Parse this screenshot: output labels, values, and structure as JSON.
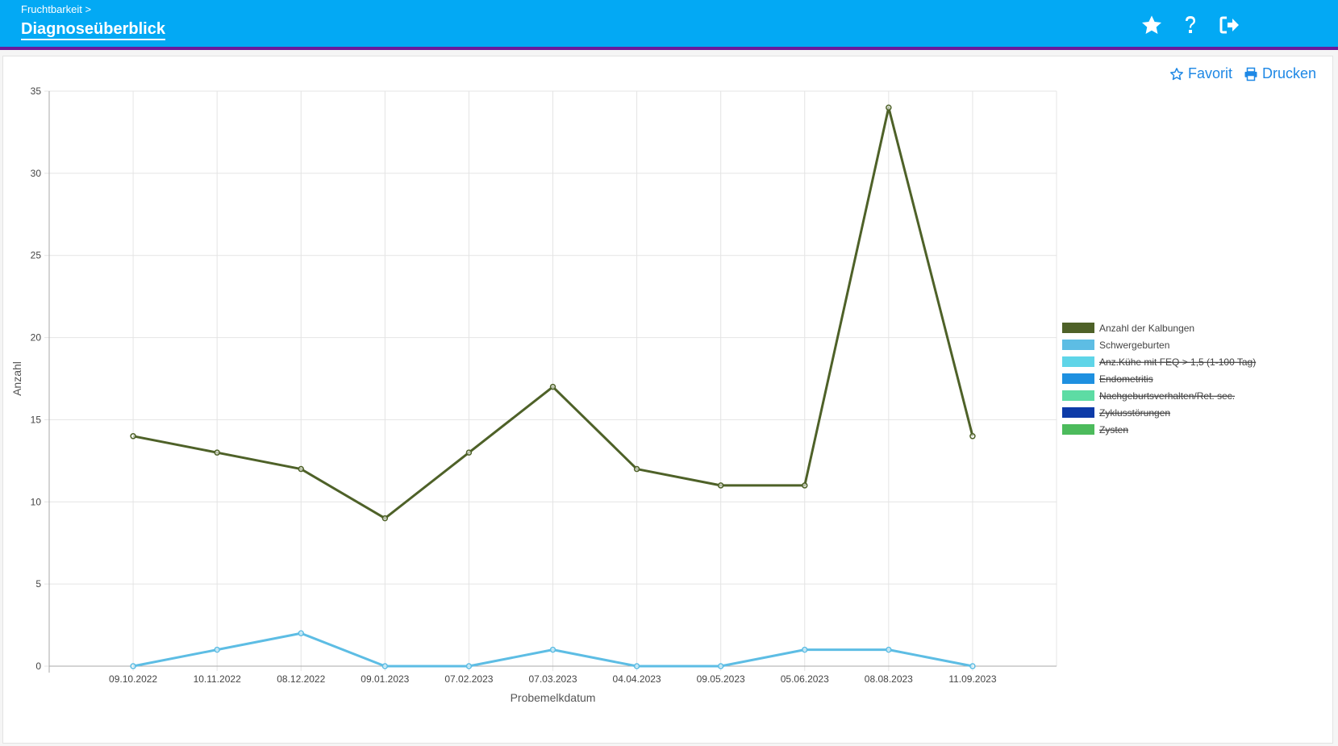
{
  "header": {
    "breadcrumb": "Fruchtbarkeit >",
    "title": "Diagnoseüberblick",
    "icons": [
      "star-icon",
      "question-icon",
      "logout-icon"
    ],
    "background": "#03a9f4",
    "accent_border": "#6a1b9a"
  },
  "actions": {
    "favorite_label": "Favorit",
    "print_label": "Drucken",
    "color": "#1e88e5"
  },
  "chart_data": {
    "type": "line",
    "xlabel": "Probemelkdatum",
    "ylabel": "Anzahl",
    "ylim": [
      0,
      35
    ],
    "yticks": [
      0,
      5,
      10,
      15,
      20,
      25,
      30,
      35
    ],
    "grid": true,
    "legend_position": "right",
    "categories": [
      "09.10.2022",
      "10.11.2022",
      "08.12.2022",
      "09.01.2023",
      "07.02.2023",
      "07.03.2023",
      "04.04.2023",
      "09.05.2023",
      "05.06.2023",
      "08.08.2023",
      "11.09.2023"
    ],
    "series": [
      {
        "name": "Anzahl der Kalbungen",
        "color": "#4e6128",
        "hidden": false,
        "values": [
          14,
          13,
          12,
          9,
          13,
          17,
          12,
          11,
          11,
          34,
          14
        ]
      },
      {
        "name": "Schwergeburten",
        "color": "#5dbde4",
        "hidden": false,
        "values": [
          0,
          1,
          2,
          0,
          0,
          1,
          0,
          0,
          1,
          1,
          0
        ]
      },
      {
        "name": "Anz.Kühe mit FEQ > 1,5 (1-100 Tag)",
        "color": "#5fd5e8",
        "hidden": true,
        "values": []
      },
      {
        "name": "Endometritis",
        "color": "#1e90e0",
        "hidden": true,
        "values": []
      },
      {
        "name": "Nachgeburtsverhalten/Ret. sec.",
        "color": "#5ddca4",
        "hidden": true,
        "values": []
      },
      {
        "name": "Zyklusstörungen",
        "color": "#0d3ba8",
        "hidden": true,
        "values": []
      },
      {
        "name": "Zysten",
        "color": "#4cbb5c",
        "hidden": true,
        "values": []
      }
    ]
  }
}
